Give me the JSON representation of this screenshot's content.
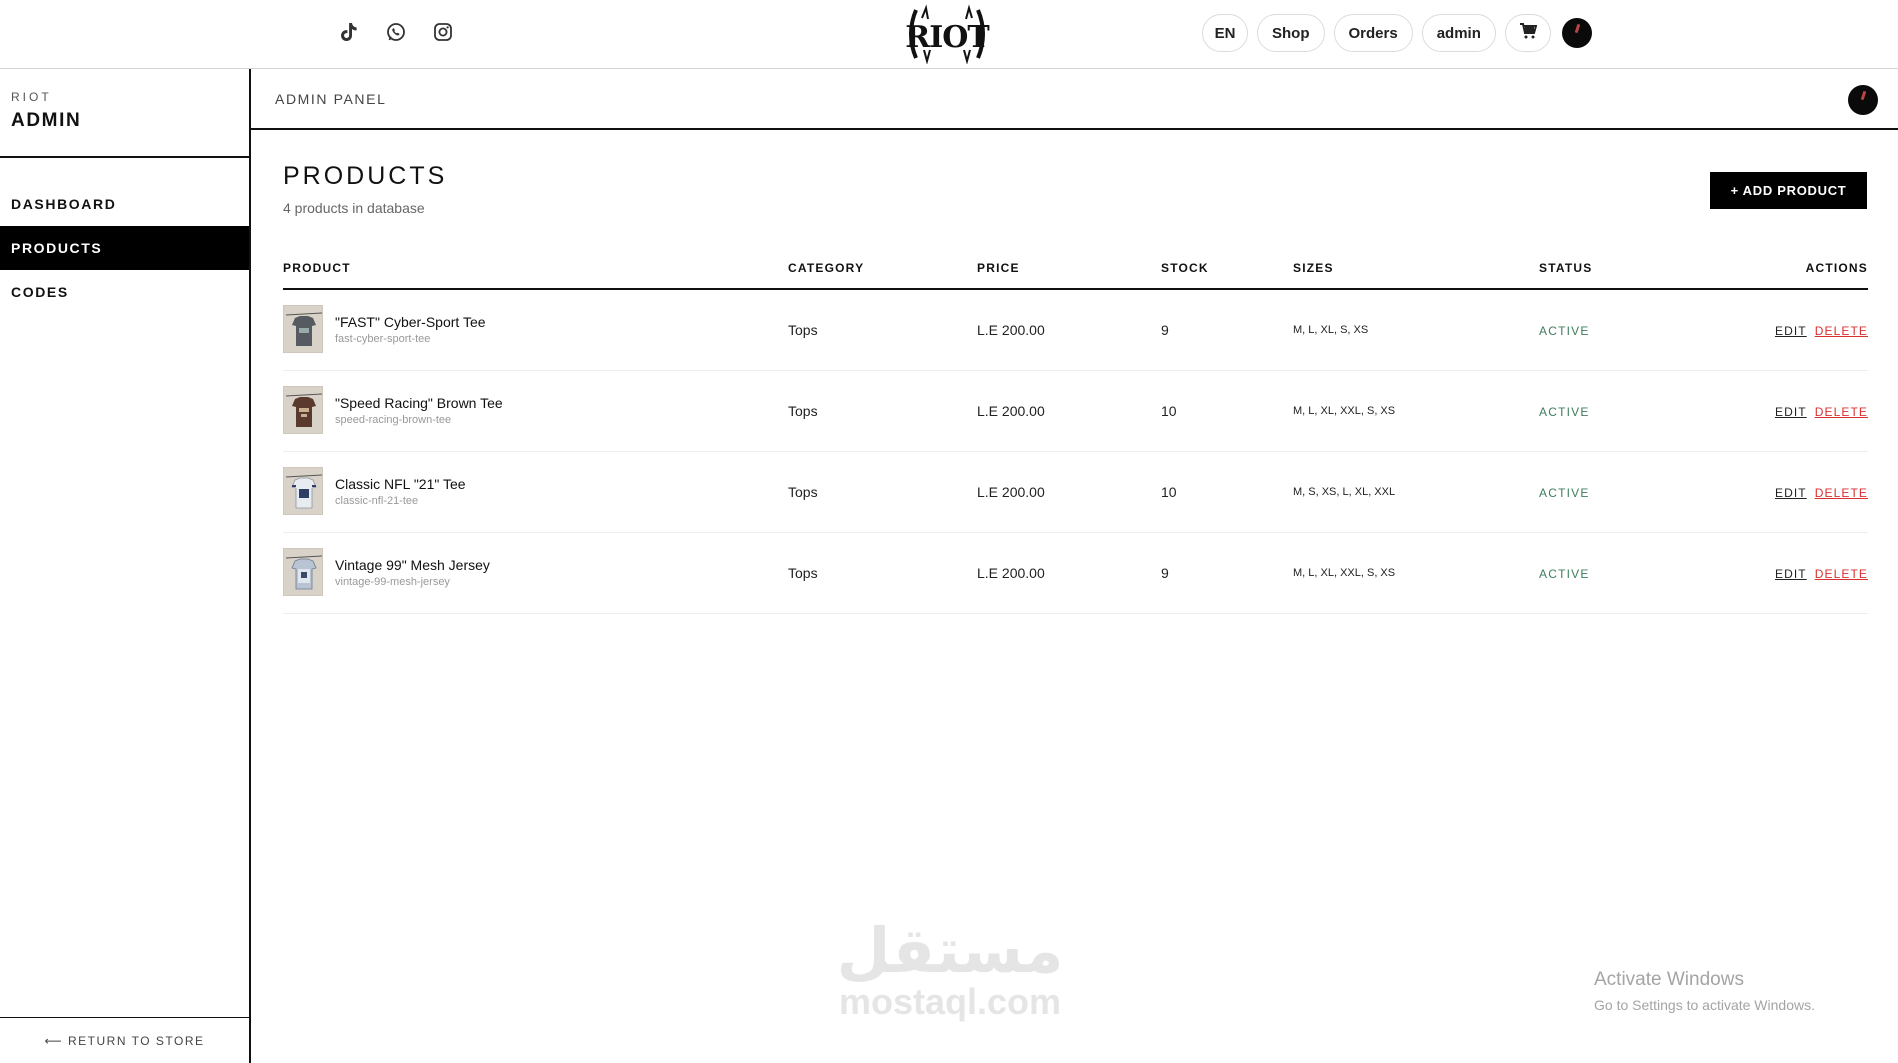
{
  "topbar": {
    "social_icons": [
      "tiktok-icon",
      "whatsapp-icon",
      "instagram-icon"
    ],
    "brand_logo": "RIOT",
    "nav": {
      "lang": "EN",
      "shop": "Shop",
      "orders": "Orders",
      "user": "admin"
    },
    "cart_icon": "cart-icon"
  },
  "sidebar": {
    "brand_sub": "RIOT",
    "brand_main": "ADMIN",
    "items": [
      {
        "label": "DASHBOARD",
        "active": false
      },
      {
        "label": "PRODUCTS",
        "active": true
      },
      {
        "label": "CODES",
        "active": false
      }
    ],
    "return_label": "⟵ RETURN TO STORE"
  },
  "panelbar": {
    "label": "ADMIN PANEL"
  },
  "main": {
    "title": "PRODUCTS",
    "subtitle": "4 products in database",
    "add_button": "+ ADD PRODUCT",
    "columns": {
      "product": "PRODUCT",
      "category": "CATEGORY",
      "price": "PRICE",
      "stock": "STOCK",
      "sizes": "SIZES",
      "status": "STATUS",
      "actions": "ACTIONS"
    },
    "rows": [
      {
        "name": "\"FAST\" Cyber-Sport Tee",
        "slug": "fast-cyber-sport-tee",
        "category": "Tops",
        "price": "L.E 200.00",
        "stock": "9",
        "sizes": "M, L, XL, S, XS",
        "status": "ACTIVE",
        "edit": "EDIT",
        "delete": "DELETE"
      },
      {
        "name": "\"Speed Racing\" Brown Tee",
        "slug": "speed-racing-brown-tee",
        "category": "Tops",
        "price": "L.E 200.00",
        "stock": "10",
        "sizes": "M, L, XL, XXL, S, XS",
        "status": "ACTIVE",
        "edit": "EDIT",
        "delete": "DELETE"
      },
      {
        "name": "Classic NFL \"21\" Tee",
        "slug": "classic-nfl-21-tee",
        "category": "Tops",
        "price": "L.E 200.00",
        "stock": "10",
        "sizes": "M, S, XS, L, XL, XXL",
        "status": "ACTIVE",
        "edit": "EDIT",
        "delete": "DELETE"
      },
      {
        "name": "Vintage 99\" Mesh Jersey",
        "slug": "vintage-99-mesh-jersey",
        "category": "Tops",
        "price": "L.E 200.00",
        "stock": "9",
        "sizes": "M, L, XL, XXL, S, XS",
        "status": "ACTIVE",
        "edit": "EDIT",
        "delete": "DELETE"
      }
    ]
  },
  "overlay": {
    "watermark_ar": "مستقل",
    "watermark_lat": "mostaql.com",
    "activate_title": "Activate Windows",
    "activate_sub": "Go to Settings to activate Windows."
  },
  "colors": {
    "accent": "#000000",
    "status_active": "#3e7d5c",
    "delete": "#d93030"
  }
}
